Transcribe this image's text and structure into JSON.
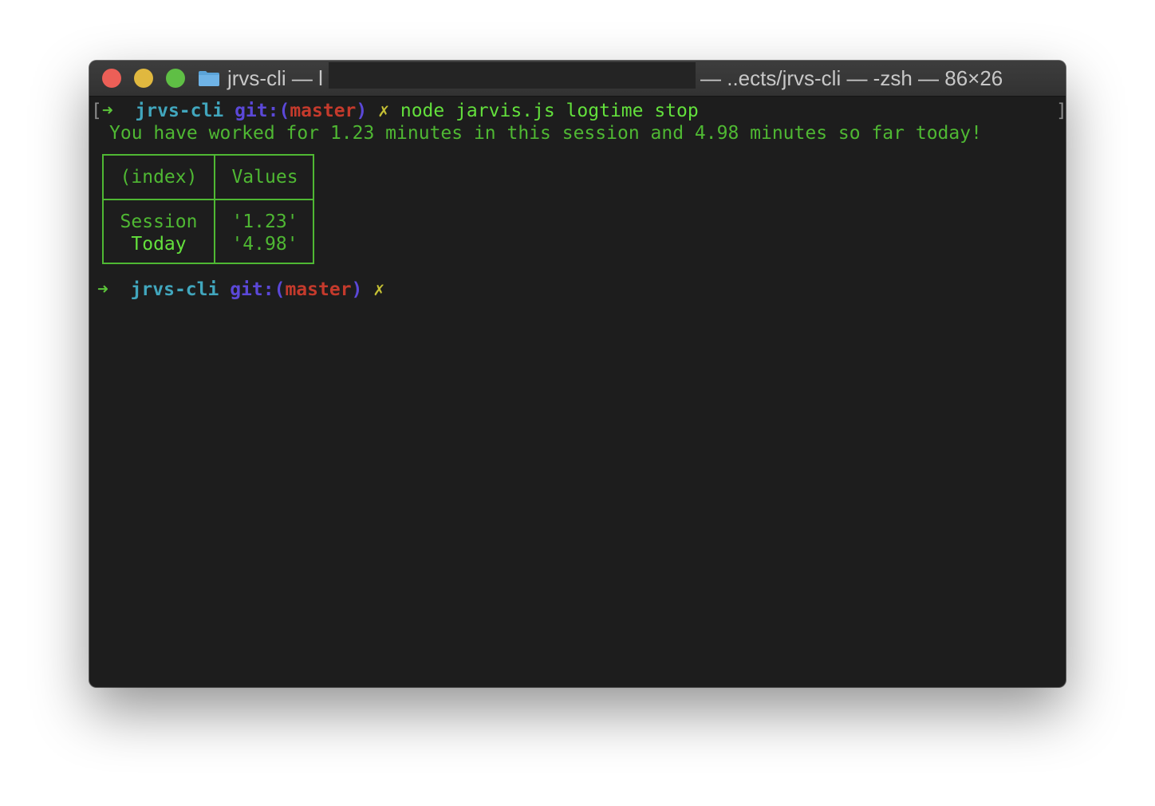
{
  "window": {
    "title_left": "jrvs-cli — l",
    "title_right": "— ..ects/jrvs-cli — -zsh — 86×26",
    "folder_icon": "folder-icon"
  },
  "prompt": {
    "arrow": "➜",
    "dir": "jrvs-cli",
    "git_label": "git:",
    "paren_open": "(",
    "branch": "master",
    "paren_close": ")",
    "dirty": "✗"
  },
  "command": "node jarvis.js logtime stop",
  "brackets": {
    "open": "[",
    "close": "]"
  },
  "output_message": "You have worked for 1.23 minutes in this session and 4.98 minutes so far today!",
  "table": {
    "headers": [
      "(index)",
      "Values"
    ],
    "rows": [
      {
        "index": "Session",
        "value": "'1.23'"
      },
      {
        "index": "Today",
        "value": "'4.98'"
      }
    ]
  },
  "colors": {
    "background": "#1d1d1d",
    "prompt_arrow": "#5bc43a",
    "dir": "#41a6bd",
    "git": "#5b48d8",
    "branch": "#c43a2c",
    "dirty": "#c5c034",
    "output": "#4fb833"
  }
}
